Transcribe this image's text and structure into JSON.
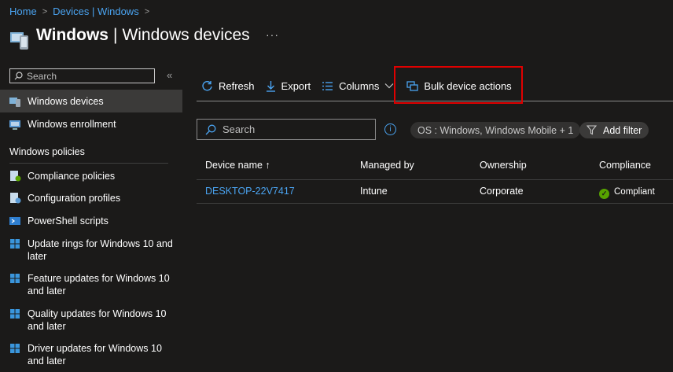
{
  "breadcrumb": {
    "home": "Home",
    "devices": "Devices | Windows"
  },
  "title": {
    "bold": "Windows",
    "sep": "|",
    "rest": "Windows devices",
    "more": "···"
  },
  "sidebar": {
    "search_placeholder": "Search",
    "collapse": "«",
    "items": [
      {
        "label": "Windows devices",
        "icon": "windows-devices-icon",
        "active": true
      },
      {
        "label": "Windows enrollment",
        "icon": "enrollment-icon"
      }
    ],
    "section_title": "Windows policies",
    "policy_items": [
      {
        "label": "Compliance policies",
        "icon": "compliance-icon"
      },
      {
        "label": "Configuration profiles",
        "icon": "configuration-icon"
      },
      {
        "label": "PowerShell scripts",
        "icon": "powershell-icon"
      },
      {
        "label_line1": "Update rings for Windows 10 and",
        "label_line2": "later",
        "icon": "windows-logo-icon"
      },
      {
        "label_line1": "Feature updates for Windows 10",
        "label_line2": "and later",
        "icon": "windows-logo-icon"
      },
      {
        "label_line1": "Quality updates for Windows 10",
        "label_line2": "and later",
        "icon": "windows-logo-icon"
      },
      {
        "label_line1": "Driver updates for Windows 10",
        "label_line2": "and later",
        "icon": "windows-logo-icon"
      }
    ]
  },
  "toolbar": {
    "refresh": "Refresh",
    "export": "Export",
    "columns": "Columns",
    "bulk": "Bulk device actions"
  },
  "filter": {
    "search_placeholder": "Search",
    "os_filter": "OS : Windows, Windows Mobile + 1",
    "add_filter": "Add filter"
  },
  "table": {
    "headers": {
      "device_name": "Device name ↑",
      "managed_by": "Managed by",
      "ownership": "Ownership",
      "compliance": "Compliance"
    },
    "rows": [
      {
        "device_name": "DESKTOP-22V7417",
        "managed_by": "Intune",
        "ownership": "Corporate",
        "compliance": "Compliant"
      }
    ]
  },
  "colors": {
    "accent": "#4aa3f0",
    "highlight": "#e00000",
    "compliant": "#57a300"
  }
}
